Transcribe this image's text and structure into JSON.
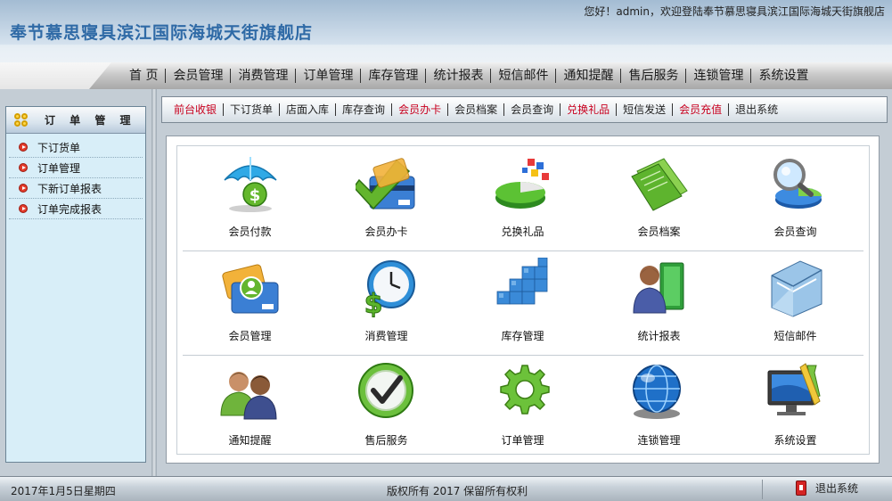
{
  "header": {
    "title": "奉节慕思寝具滨江国际海城天街旗舰店",
    "greeting": "您好！admin，欢迎登陆奉节慕思寝具滨江国际海城天街旗舰店"
  },
  "main_nav": [
    "首 页",
    "会员管理",
    "消费管理",
    "订单管理",
    "库存管理",
    "统计报表",
    "短信邮件",
    "通知提醒",
    "售后服务",
    "连锁管理",
    "系统设置"
  ],
  "sidebar": {
    "title": "订 单 管 理",
    "items": [
      "下订货单",
      "订单管理",
      "下新订单报表",
      "订单完成报表"
    ]
  },
  "quick_nav": [
    {
      "label": "前台收银",
      "highlight": true
    },
    {
      "label": "下订货单",
      "highlight": false
    },
    {
      "label": "店面入库",
      "highlight": false
    },
    {
      "label": "库存查询",
      "highlight": false
    },
    {
      "label": "会员办卡",
      "highlight": true
    },
    {
      "label": "会员档案",
      "highlight": false
    },
    {
      "label": "会员查询",
      "highlight": false
    },
    {
      "label": "兑换礼品",
      "highlight": true
    },
    {
      "label": "短信发送",
      "highlight": false
    },
    {
      "label": "会员充值",
      "highlight": true
    },
    {
      "label": "退出系统",
      "highlight": false
    }
  ],
  "grid": [
    [
      {
        "label": "会员付款",
        "icon": "umbrella-dollar-icon"
      },
      {
        "label": "会员办卡",
        "icon": "card-check-icon"
      },
      {
        "label": "兑换礼品",
        "icon": "pie-chart-icon"
      },
      {
        "label": "会员档案",
        "icon": "folder-icon"
      },
      {
        "label": "会员查询",
        "icon": "magnifier-pie-icon"
      }
    ],
    [
      {
        "label": "会员管理",
        "icon": "member-cards-icon"
      },
      {
        "label": "消费管理",
        "icon": "clock-dollar-icon"
      },
      {
        "label": "库存管理",
        "icon": "cubes-icon"
      },
      {
        "label": "统计报表",
        "icon": "person-book-icon"
      },
      {
        "label": "短信邮件",
        "icon": "mail-folder-icon"
      }
    ],
    [
      {
        "label": "通知提醒",
        "icon": "users-icon"
      },
      {
        "label": "售后服务",
        "icon": "checkmark-icon"
      },
      {
        "label": "订单管理",
        "icon": "gear-icon"
      },
      {
        "label": "连锁管理",
        "icon": "globe-icon"
      },
      {
        "label": "系统设置",
        "icon": "monitor-tools-icon"
      }
    ]
  ],
  "footer": {
    "date": "2017年1月5日星期四",
    "copyright": "版权所有 2017 保留所有权利",
    "logout": "退出系统"
  },
  "colors": {
    "title_blue": "#2f6aa6",
    "highlight_red": "#c8001e",
    "sidebar_bg": "#d8eef8"
  }
}
